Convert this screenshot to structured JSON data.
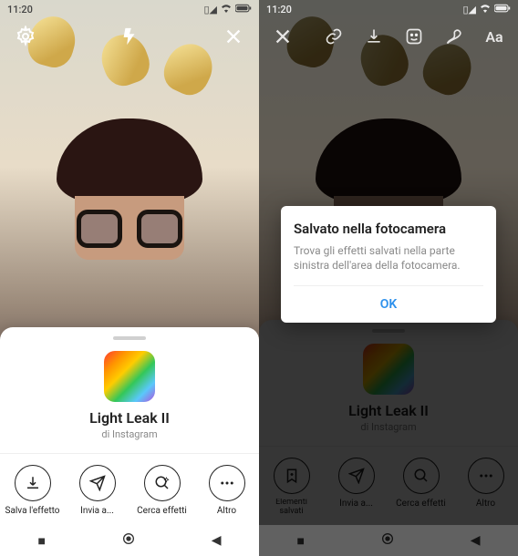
{
  "status": {
    "time": "11:20",
    "signal_icon": "signal-icon",
    "wifi_icon": "wifi-icon",
    "battery_icon": "battery-icon"
  },
  "left": {
    "top_icons": {
      "settings": "settings-icon",
      "flash": "flash-icon",
      "close": "close-icon"
    },
    "effect": {
      "title": "Light Leak II",
      "subtitle_prefix": "di",
      "subtitle_author": "Instagram"
    },
    "actions": [
      {
        "name": "save-effect",
        "label": "Salva l'effetto",
        "icon": "download-icon"
      },
      {
        "name": "send-to",
        "label": "Invia a...",
        "icon": "send-icon"
      },
      {
        "name": "search-effects",
        "label": "Cerca effetti",
        "icon": "search-sparkle-icon"
      },
      {
        "name": "more",
        "label": "Altro",
        "icon": "more-icon"
      }
    ]
  },
  "right": {
    "top_icons": {
      "close": "close-icon",
      "link": "link-icon",
      "download": "download-icon",
      "sticker": "sticker-icon",
      "draw": "draw-icon",
      "text": "Aa"
    },
    "effect": {
      "title": "Light Leak II",
      "subtitle_prefix": "di",
      "subtitle_author": "Instagram"
    },
    "actions": [
      {
        "name": "saved-elements",
        "label": "Elementi salvati",
        "icon": "bookmark-plus-icon"
      },
      {
        "name": "send-to",
        "label": "Invia a...",
        "icon": "send-icon"
      },
      {
        "name": "search-effects",
        "label": "Cerca effetti",
        "icon": "search-sparkle-icon"
      },
      {
        "name": "more",
        "label": "Altro",
        "icon": "more-icon"
      }
    ],
    "dialog": {
      "title": "Salvato nella fotocamera",
      "body": "Trova gli effetti salvati nella parte sinistra dell'area della fotocamera.",
      "ok": "OK"
    }
  },
  "nav": {
    "recent": "recent-apps-icon",
    "home": "home-icon",
    "back": "back-icon"
  }
}
